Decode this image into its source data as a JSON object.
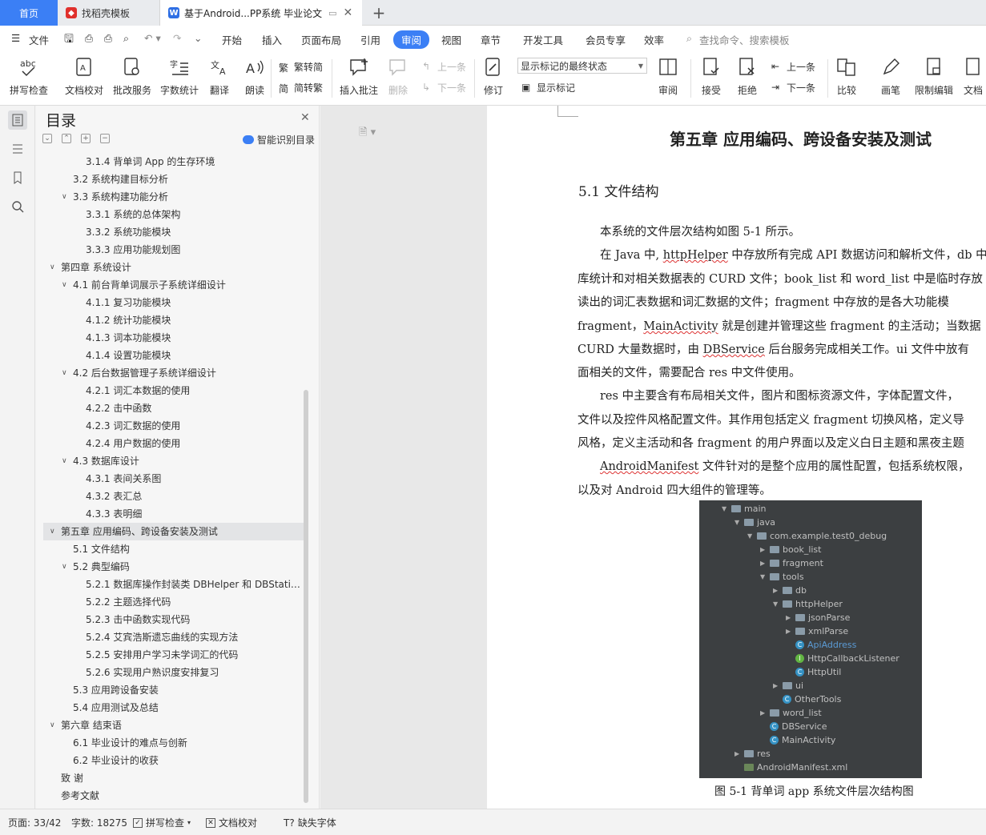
{
  "tabs": {
    "home": "首页",
    "template": "找稻壳模板",
    "doc": "基于Android...PP系统 毕业论文"
  },
  "menu": {
    "file": "文件",
    "items": [
      "开始",
      "插入",
      "页面布局",
      "引用",
      "审阅",
      "视图",
      "章节",
      "开发工具",
      "会员专享",
      "效率"
    ],
    "search": "查找命令、搜索模板"
  },
  "ribbon": {
    "spell": "拼写检查",
    "proof": "文档校对",
    "batch": "批改服务",
    "wordcount": "字数统计",
    "translate": "翻译",
    "read": "朗读",
    "trad": "繁转简",
    "simp": "简转繁",
    "insert_comment": "插入批注",
    "delete": "删除",
    "prev": "上一条",
    "next": "下一条",
    "revise": "修订",
    "markup_state": "显示标记的最终状态",
    "show_markup": "显示标记",
    "review": "审阅",
    "accept": "接受",
    "reject": "拒绝",
    "prev2": "上一条",
    "next2": "下一条",
    "compare": "比较",
    "pen": "画笔",
    "restrict": "限制编辑",
    "docpart": "文档"
  },
  "toc": {
    "title": "目录",
    "smart": "智能识别目录",
    "items": [
      {
        "label": "3.1.4  背单词 App 的生存环境",
        "level": 3
      },
      {
        "label": "3.2    系统构建目标分析",
        "level": 2
      },
      {
        "label": "3.3    系统构建功能分析",
        "level": 2,
        "arrow": true
      },
      {
        "label": "3.3.1  系统的总体架构",
        "level": 3
      },
      {
        "label": "3.3.2  系统功能模块",
        "level": 3
      },
      {
        "label": "3.3.3  应用功能规划图",
        "level": 3
      },
      {
        "label": "第四章  系统设计",
        "level": 1,
        "arrow": true
      },
      {
        "label": "4.1    前台背单词展示子系统详细设计",
        "level": 2,
        "arrow": true
      },
      {
        "label": "4.1.1  复习功能模块",
        "level": 3
      },
      {
        "label": "4.1.2  统计功能模块",
        "level": 3
      },
      {
        "label": "4.1.3  词本功能模块",
        "level": 3
      },
      {
        "label": "4.1.4  设置功能模块",
        "level": 3
      },
      {
        "label": "4.2    后台数据管理子系统详细设计",
        "level": 2,
        "arrow": true
      },
      {
        "label": "4.2.1 词汇本数据的使用",
        "level": 3
      },
      {
        "label": "4.2.2 击中函数",
        "level": 3
      },
      {
        "label": "4.2.3 词汇数据的使用",
        "level": 3
      },
      {
        "label": "4.2.4  用户数据的使用",
        "level": 3
      },
      {
        "label": "4.3    数据库设计",
        "level": 2,
        "arrow": true
      },
      {
        "label": "4.3.1  表间关系图",
        "level": 3
      },
      {
        "label": "4.3.2  表汇总",
        "level": 3
      },
      {
        "label": "4.3.3  表明细",
        "level": 3
      },
      {
        "label": "第五章  应用编码、跨设备安装及测试",
        "level": 1,
        "arrow": true
      },
      {
        "label": "5.1    文件结构",
        "level": 2
      },
      {
        "label": "5.2    典型编码",
        "level": 2,
        "arrow": true
      },
      {
        "label": "5.2.1  数据库操作封装类 DBHelper 和 DBStati…",
        "level": 3
      },
      {
        "label": "5.2.2  主题选择代码",
        "level": 3
      },
      {
        "label": "5.2.3  击中函数实现代码",
        "level": 3
      },
      {
        "label": "5.2.4 艾宾浩斯遗忘曲线的实现方法",
        "level": 3
      },
      {
        "label": "5.2.5 安排用户学习未学词汇的代码",
        "level": 3
      },
      {
        "label": "5.2.6  实现用户熟识度安排复习",
        "level": 3
      },
      {
        "label": "5.3    应用跨设备安装",
        "level": 2
      },
      {
        "label": "5.4    应用测试及总结",
        "level": 2
      },
      {
        "label": "第六章  结束语",
        "level": 1,
        "arrow": true
      },
      {
        "label": "6.1    毕业设计的难点与创新",
        "level": 2
      },
      {
        "label": "6.2    毕业设计的收获",
        "level": 2
      },
      {
        "label": "致    谢",
        "level": 1
      },
      {
        "label": "参考文献",
        "level": 1
      }
    ]
  },
  "doc": {
    "chapter": "第五章  应用编码、跨设备安装及测试",
    "section": "5.1    文件结构",
    "p1": "本系统的文件层次结构如图 5-1 所示。",
    "p2a": "在 Java 中, ",
    "p2b": "httpHelper",
    "p2c": " 中存放所有完成 API 数据访问和解析文件，db 中",
    "p3": "库统计和对相关数据表的 CURD 文件；book_list 和 word_list 中是临时存放",
    "p4": "读出的词汇表数据和词汇数据的文件；fragment 中存放的是各大功能模",
    "p5a": "fragment，",
    "p5b": "MainActivity",
    "p5c": " 就是创建并管理这些 fragment 的主活动；当数据",
    "p6a": "CURD 大量数据时，由 ",
    "p6b": "DBService",
    "p6c": " 后台服务完成相关工作。ui 文件中放有",
    "p7": "面相关的文件，需要配合 res 中文件使用。",
    "p8": "res 中主要含有布局相关文件，图片和图标资源文件，字体配置文件，",
    "p9": "文件以及控件风格配置文件。其作用包括定义 fragment 切换风格，定义导",
    "p10": "风格，定义主活动和各 fragment 的用户界面以及定义白日主题和黑夜主题",
    "p11a": "AndroidManifest",
    "p11b": " 文件针对的是整个应用的属性配置，包括系统权限，",
    "p12": "以及对 Android 四大组件的管理等。",
    "caption": "图 5-1  背单词 app 系统文件层次结构图",
    "tree": [
      {
        "label": "main",
        "depth": 0,
        "type": "folder",
        "arrow": "▼"
      },
      {
        "label": "java",
        "depth": 1,
        "type": "folder",
        "arrow": "▼"
      },
      {
        "label": "com.example.test0_debug",
        "depth": 2,
        "type": "folder",
        "arrow": "▼"
      },
      {
        "label": "book_list",
        "depth": 3,
        "type": "folder",
        "arrow": "▶"
      },
      {
        "label": "fragment",
        "depth": 3,
        "type": "folder",
        "arrow": "▶"
      },
      {
        "label": "tools",
        "depth": 3,
        "type": "folder",
        "arrow": "▼"
      },
      {
        "label": "db",
        "depth": 4,
        "type": "folder",
        "arrow": "▶"
      },
      {
        "label": "httpHelper",
        "depth": 4,
        "type": "folder",
        "arrow": "▼"
      },
      {
        "label": "jsonParse",
        "depth": 5,
        "type": "folder",
        "arrow": "▶"
      },
      {
        "label": "xmlParse",
        "depth": 5,
        "type": "folder",
        "arrow": "▶"
      },
      {
        "label": "ApiAddress",
        "depth": 5,
        "type": "class",
        "arrow": "",
        "color": "#5b9bd5"
      },
      {
        "label": "HttpCallbackListener",
        "depth": 5,
        "type": "iface",
        "arrow": ""
      },
      {
        "label": "HttpUtil",
        "depth": 5,
        "type": "class",
        "arrow": ""
      },
      {
        "label": "ui",
        "depth": 4,
        "type": "folder",
        "arrow": "▶"
      },
      {
        "label": "OtherTools",
        "depth": 4,
        "type": "class",
        "arrow": ""
      },
      {
        "label": "word_list",
        "depth": 3,
        "type": "folder",
        "arrow": "▶"
      },
      {
        "label": "DBService",
        "depth": 3,
        "type": "class",
        "arrow": ""
      },
      {
        "label": "MainActivity",
        "depth": 3,
        "type": "class",
        "arrow": ""
      },
      {
        "label": "res",
        "depth": 1,
        "type": "folder",
        "arrow": "▶"
      },
      {
        "label": "AndroidManifest.xml",
        "depth": 1,
        "type": "xml",
        "arrow": ""
      }
    ]
  },
  "status": {
    "page": "页面: 33/42",
    "words": "字数: 18275",
    "spell": "拼写检查",
    "proof": "文档校对",
    "font": "缺失字体"
  },
  "colors": {
    "accent": "#3b7ff5",
    "figure_bg": "#3c3f41"
  }
}
